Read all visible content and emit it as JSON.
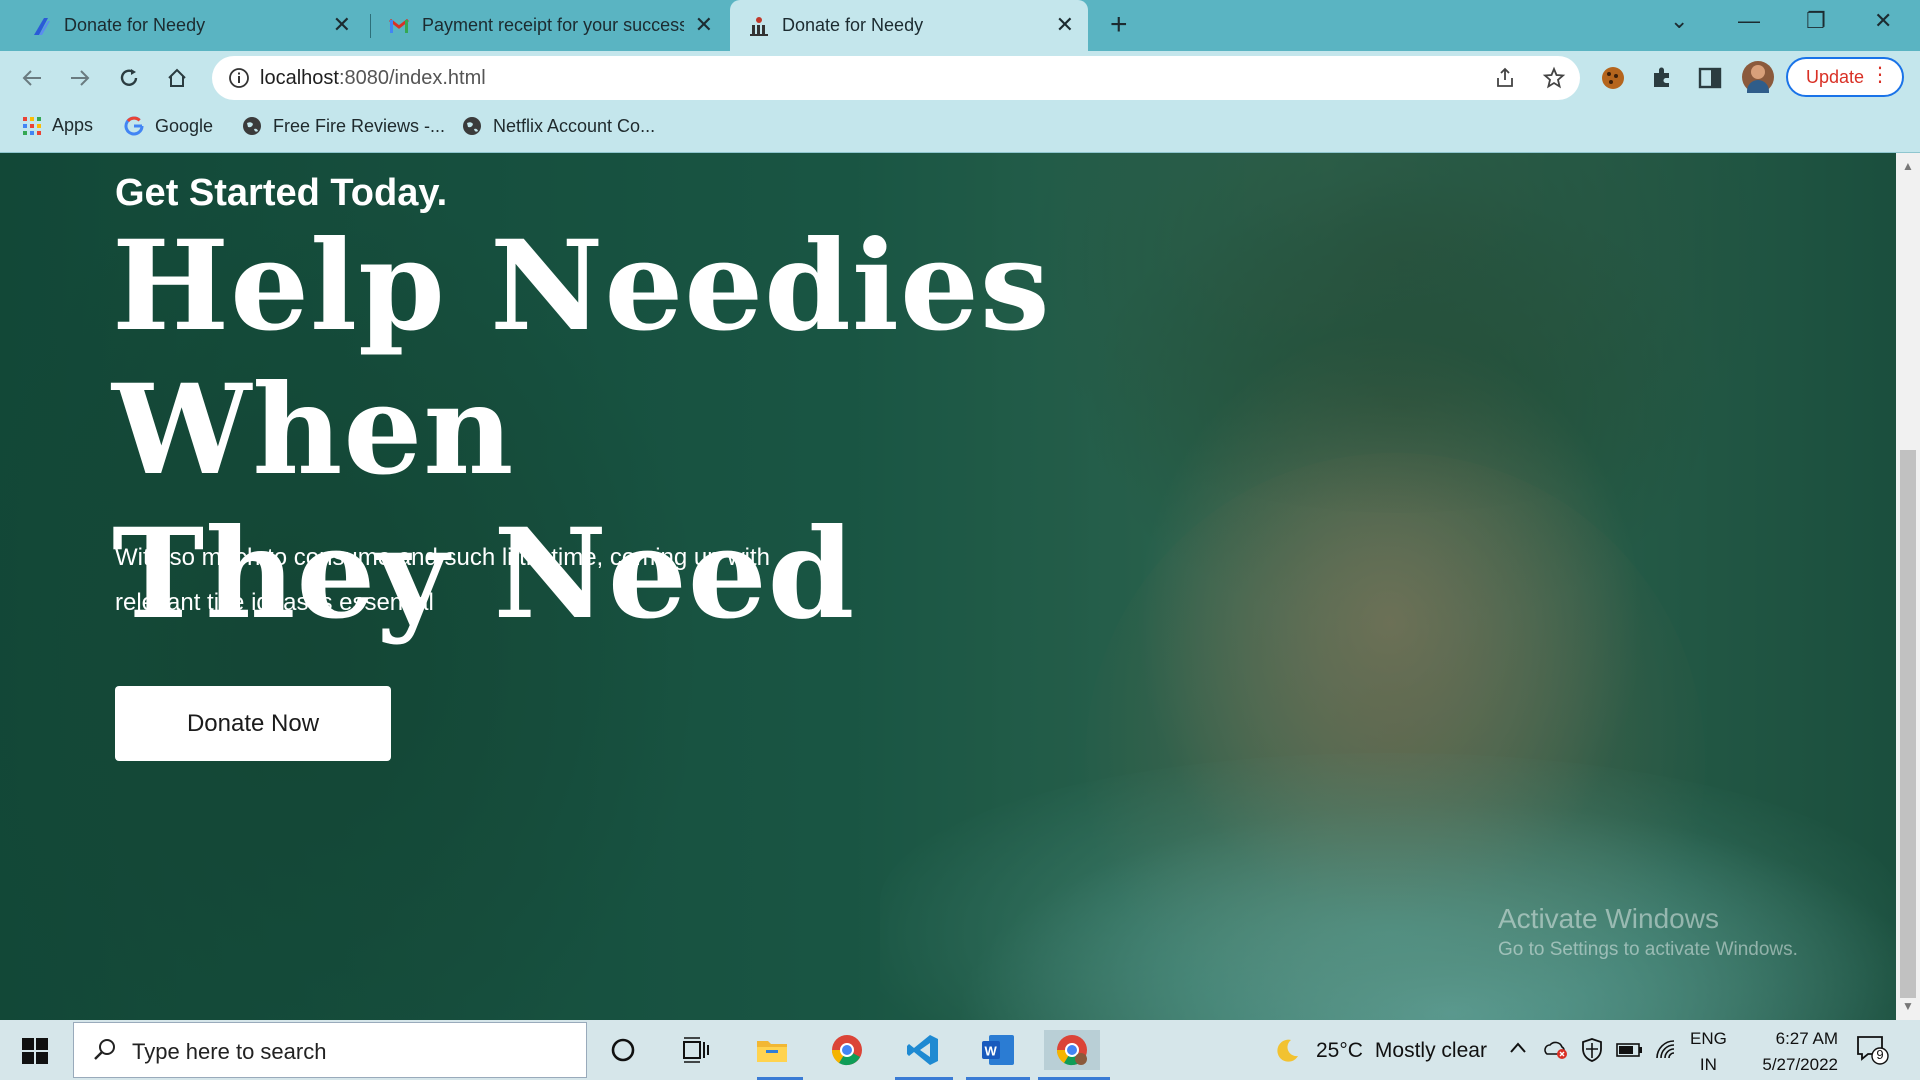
{
  "browser": {
    "tabs": [
      {
        "title": "Donate for Needy",
        "active": false,
        "icon": "app-icon"
      },
      {
        "title": "Payment receipt for your successful",
        "active": false,
        "icon": "gmail-icon"
      },
      {
        "title": "Donate for Needy",
        "active": true,
        "icon": "charity-icon"
      }
    ],
    "url_host": "localhost",
    "url_path": ":8080/index.html",
    "update_label": "Update",
    "bookmarks": [
      {
        "label": "Apps",
        "icon": "apps-grid-icon"
      },
      {
        "label": "Google",
        "icon": "google-icon"
      },
      {
        "label": "Free Fire Reviews -...",
        "icon": "globe-icon"
      },
      {
        "label": "Netflix Account Co...",
        "icon": "globe-icon"
      }
    ]
  },
  "hero": {
    "eyebrow": "Get Started Today.",
    "headline_line1": "Help Needies When",
    "headline_line2": "They Need",
    "subtitle": "With so much to consume and such little time, coming up with relevant title ideas is essential",
    "cta_label": "Donate Now"
  },
  "watermark": {
    "line1": "Activate Windows",
    "line2": "Go to Settings to activate Windows."
  },
  "taskbar": {
    "search_placeholder": "Type here to search",
    "weather_temp": "25°C",
    "weather_desc": "Mostly clear",
    "lang_line1": "ENG",
    "lang_line2": "IN",
    "time": "6:27 AM",
    "date": "5/27/2022",
    "notification_count": "9"
  },
  "colors": {
    "tabbar": "#5ab4c2",
    "toolbar": "#c4e6ec",
    "update_text": "#d93025",
    "hero_overlay": "#1d5443"
  }
}
